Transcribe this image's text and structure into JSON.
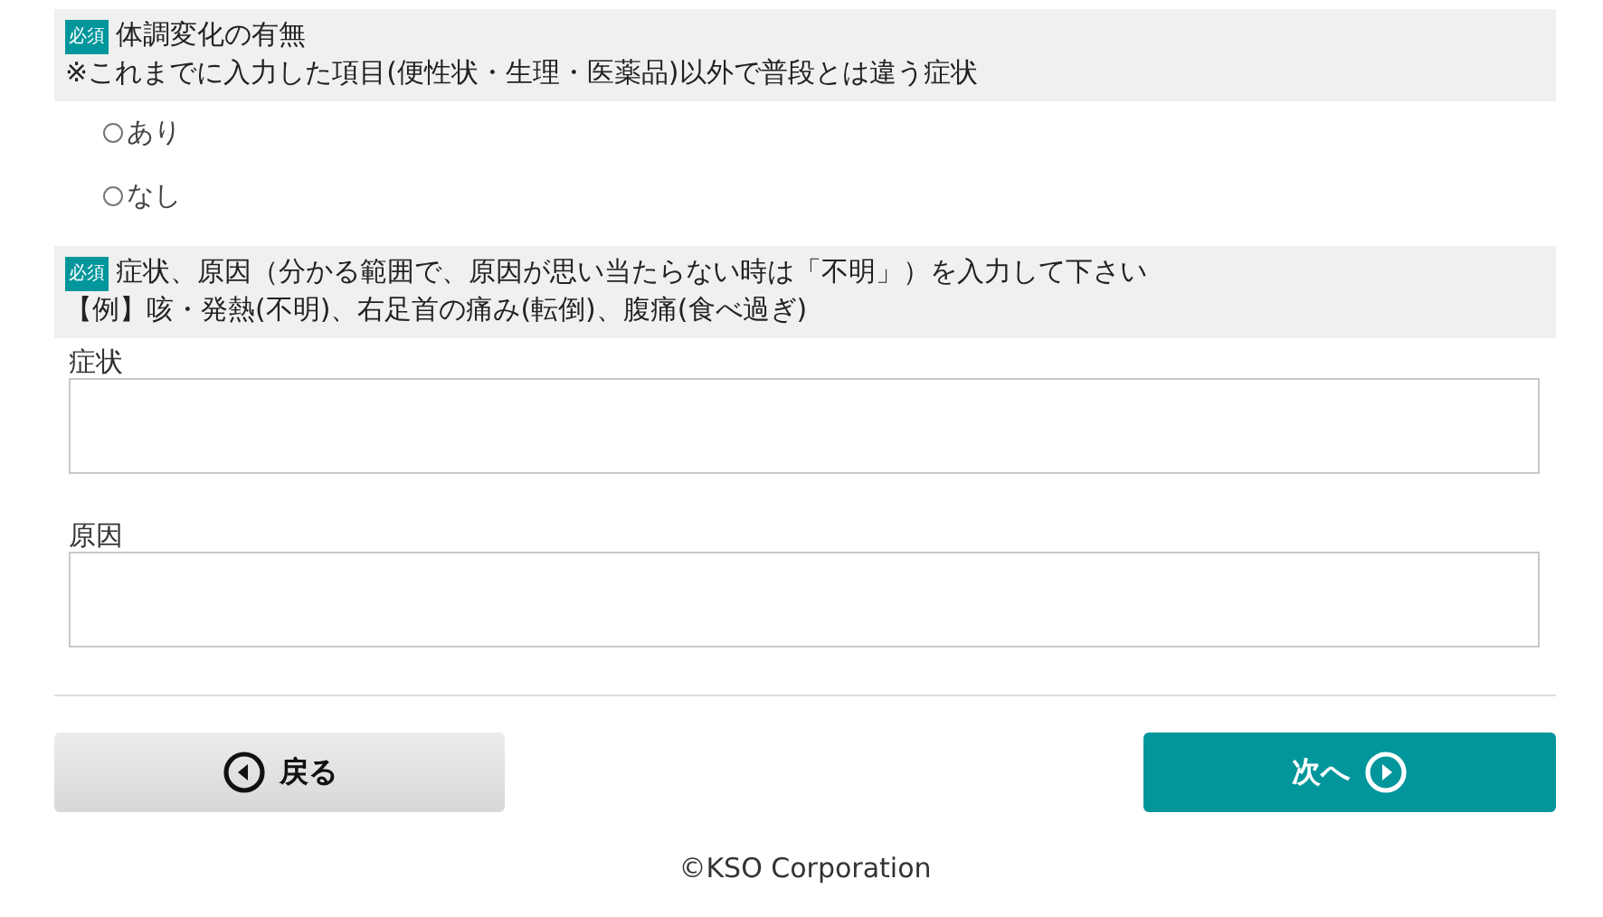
{
  "sections": [
    {
      "badge": "必須",
      "title": "体調変化の有無",
      "note": "※これまでに入力した項目(便性状・生理・医薬品)以外で普段とは違う症状",
      "options": [
        {
          "label": "あり",
          "selected": false
        },
        {
          "label": "なし",
          "selected": false
        }
      ]
    },
    {
      "badge": "必須",
      "title": "症状、原因（分かる範囲で、原因が思い当たらない時は「不明」）を入力して下さい",
      "note": "【例】咳・発熱(不明)、右足首の痛み(転倒)、腹痛(食べ過ぎ)",
      "fields": [
        {
          "label": "症状"
        },
        {
          "label": "原因"
        }
      ]
    }
  ],
  "buttons": [
    {
      "kind": "back",
      "label": "戻る"
    },
    {
      "kind": "next",
      "label": "次へ"
    }
  ],
  "footer": "©KSO Corporation"
}
